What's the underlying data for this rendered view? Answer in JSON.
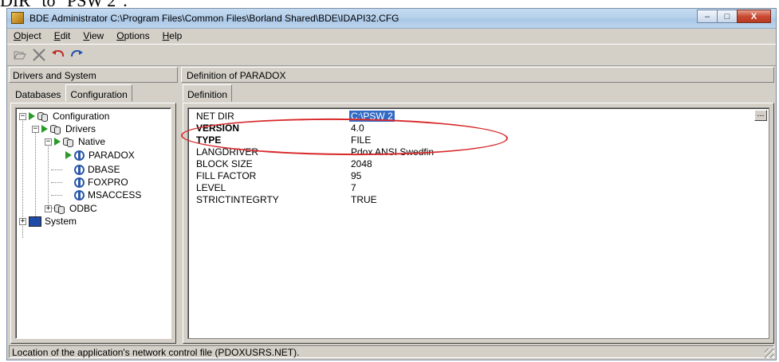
{
  "page_caption": "DIR\" to \"PSW 2\".",
  "window": {
    "title": "BDE Administrator  C:\\Program Files\\Common Files\\Borland Shared\\BDE\\IDAPI32.CFG",
    "minimize": "–",
    "maximize": "□",
    "close": "X"
  },
  "menu": [
    "Object",
    "Edit",
    "View",
    "Options",
    "Help"
  ],
  "toolbar": {
    "icons": [
      "open-icon",
      "delete-icon",
      "undo-icon",
      "redo-icon"
    ]
  },
  "left": {
    "header": "Drivers and System",
    "tabs": [
      "Databases",
      "Configuration"
    ],
    "active_tab": "Configuration",
    "tree": {
      "configuration": "Configuration",
      "drivers": "Drivers",
      "native": "Native",
      "paradox": "PARADOX",
      "dbase": "DBASE",
      "foxpro": "FOXPRO",
      "msaccess": "MSACCESS",
      "odbc": "ODBC",
      "system": "System"
    }
  },
  "right": {
    "header": "Definition of PARADOX",
    "tab": "Definition",
    "rows": [
      {
        "key": "NET DIR",
        "value": "C:\\PSW 2",
        "bold": false,
        "selected": true
      },
      {
        "key": "VERSION",
        "value": "4.0",
        "bold": true,
        "selected": false
      },
      {
        "key": "TYPE",
        "value": "FILE",
        "bold": true,
        "selected": false
      },
      {
        "key": "LANGDRIVER",
        "value": "Pdox ANSI Swedfin",
        "bold": false,
        "selected": false
      },
      {
        "key": "BLOCK SIZE",
        "value": "2048",
        "bold": false,
        "selected": false
      },
      {
        "key": "FILL FACTOR",
        "value": "95",
        "bold": false,
        "selected": false
      },
      {
        "key": "LEVEL",
        "value": "7",
        "bold": false,
        "selected": false
      },
      {
        "key": "STRICTINTEGRTY",
        "value": "TRUE",
        "bold": false,
        "selected": false
      }
    ],
    "ellipsis": "..."
  },
  "status": "Location of the application's network control file (PDOXUSRS.NET).",
  "colors": {
    "selection": "#316ac5",
    "annotation": "#d8282a",
    "window_face": "#d4d0c8"
  }
}
